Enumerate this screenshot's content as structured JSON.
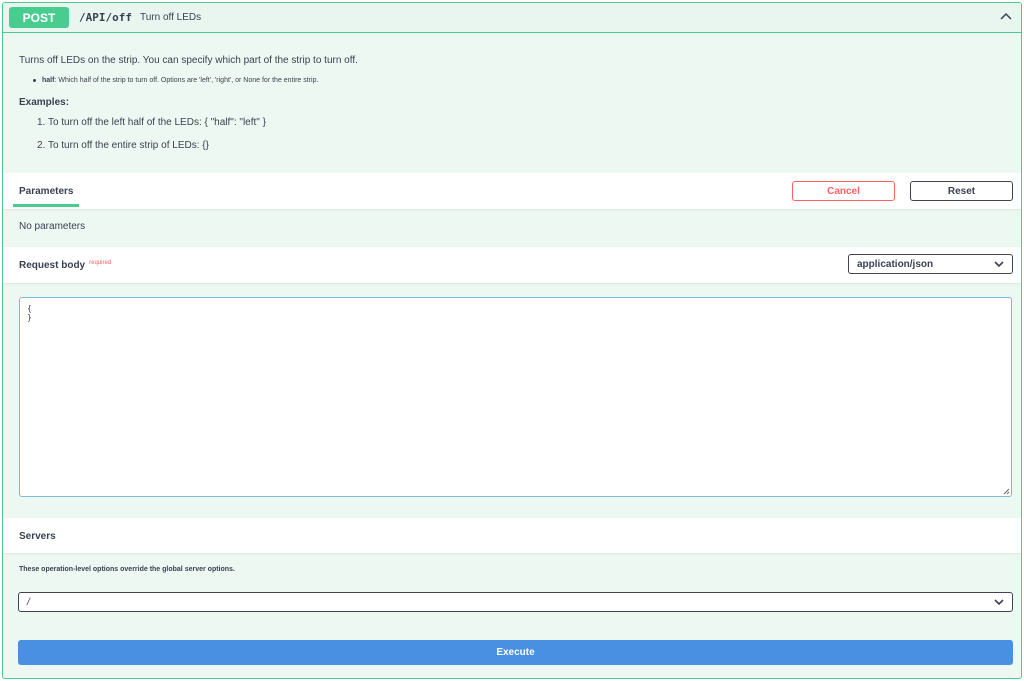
{
  "summary": {
    "method": "POST",
    "path": "/API/off",
    "description": "Turn off LEDs"
  },
  "description": {
    "main": "Turns off LEDs on the strip. You can specify which part of the strip to turn off.",
    "param_name": "half",
    "param_text": ": Which half of the strip to turn off. Options are 'left', 'right', or None for the entire strip.",
    "examples_title": "Examples:",
    "example_1": "1. To turn off the left half of the LEDs: { \"half\": \"left\" }",
    "example_2": "2. To turn off the entire strip of LEDs: {}"
  },
  "parameters": {
    "tab_label": "Parameters",
    "cancel_label": "Cancel",
    "reset_label": "Reset",
    "empty_text": "No parameters"
  },
  "request_body": {
    "title": "Request body",
    "required_label": "required",
    "content_type": "application/json",
    "value": "{\n}"
  },
  "servers": {
    "title": "Servers",
    "note": "These operation-level options override the global server options.",
    "selected": "/"
  },
  "execute_label": "Execute",
  "colors": {
    "post_green": "#49cc90",
    "cancel_red": "#ff6060",
    "execute_blue": "#4990e2"
  }
}
